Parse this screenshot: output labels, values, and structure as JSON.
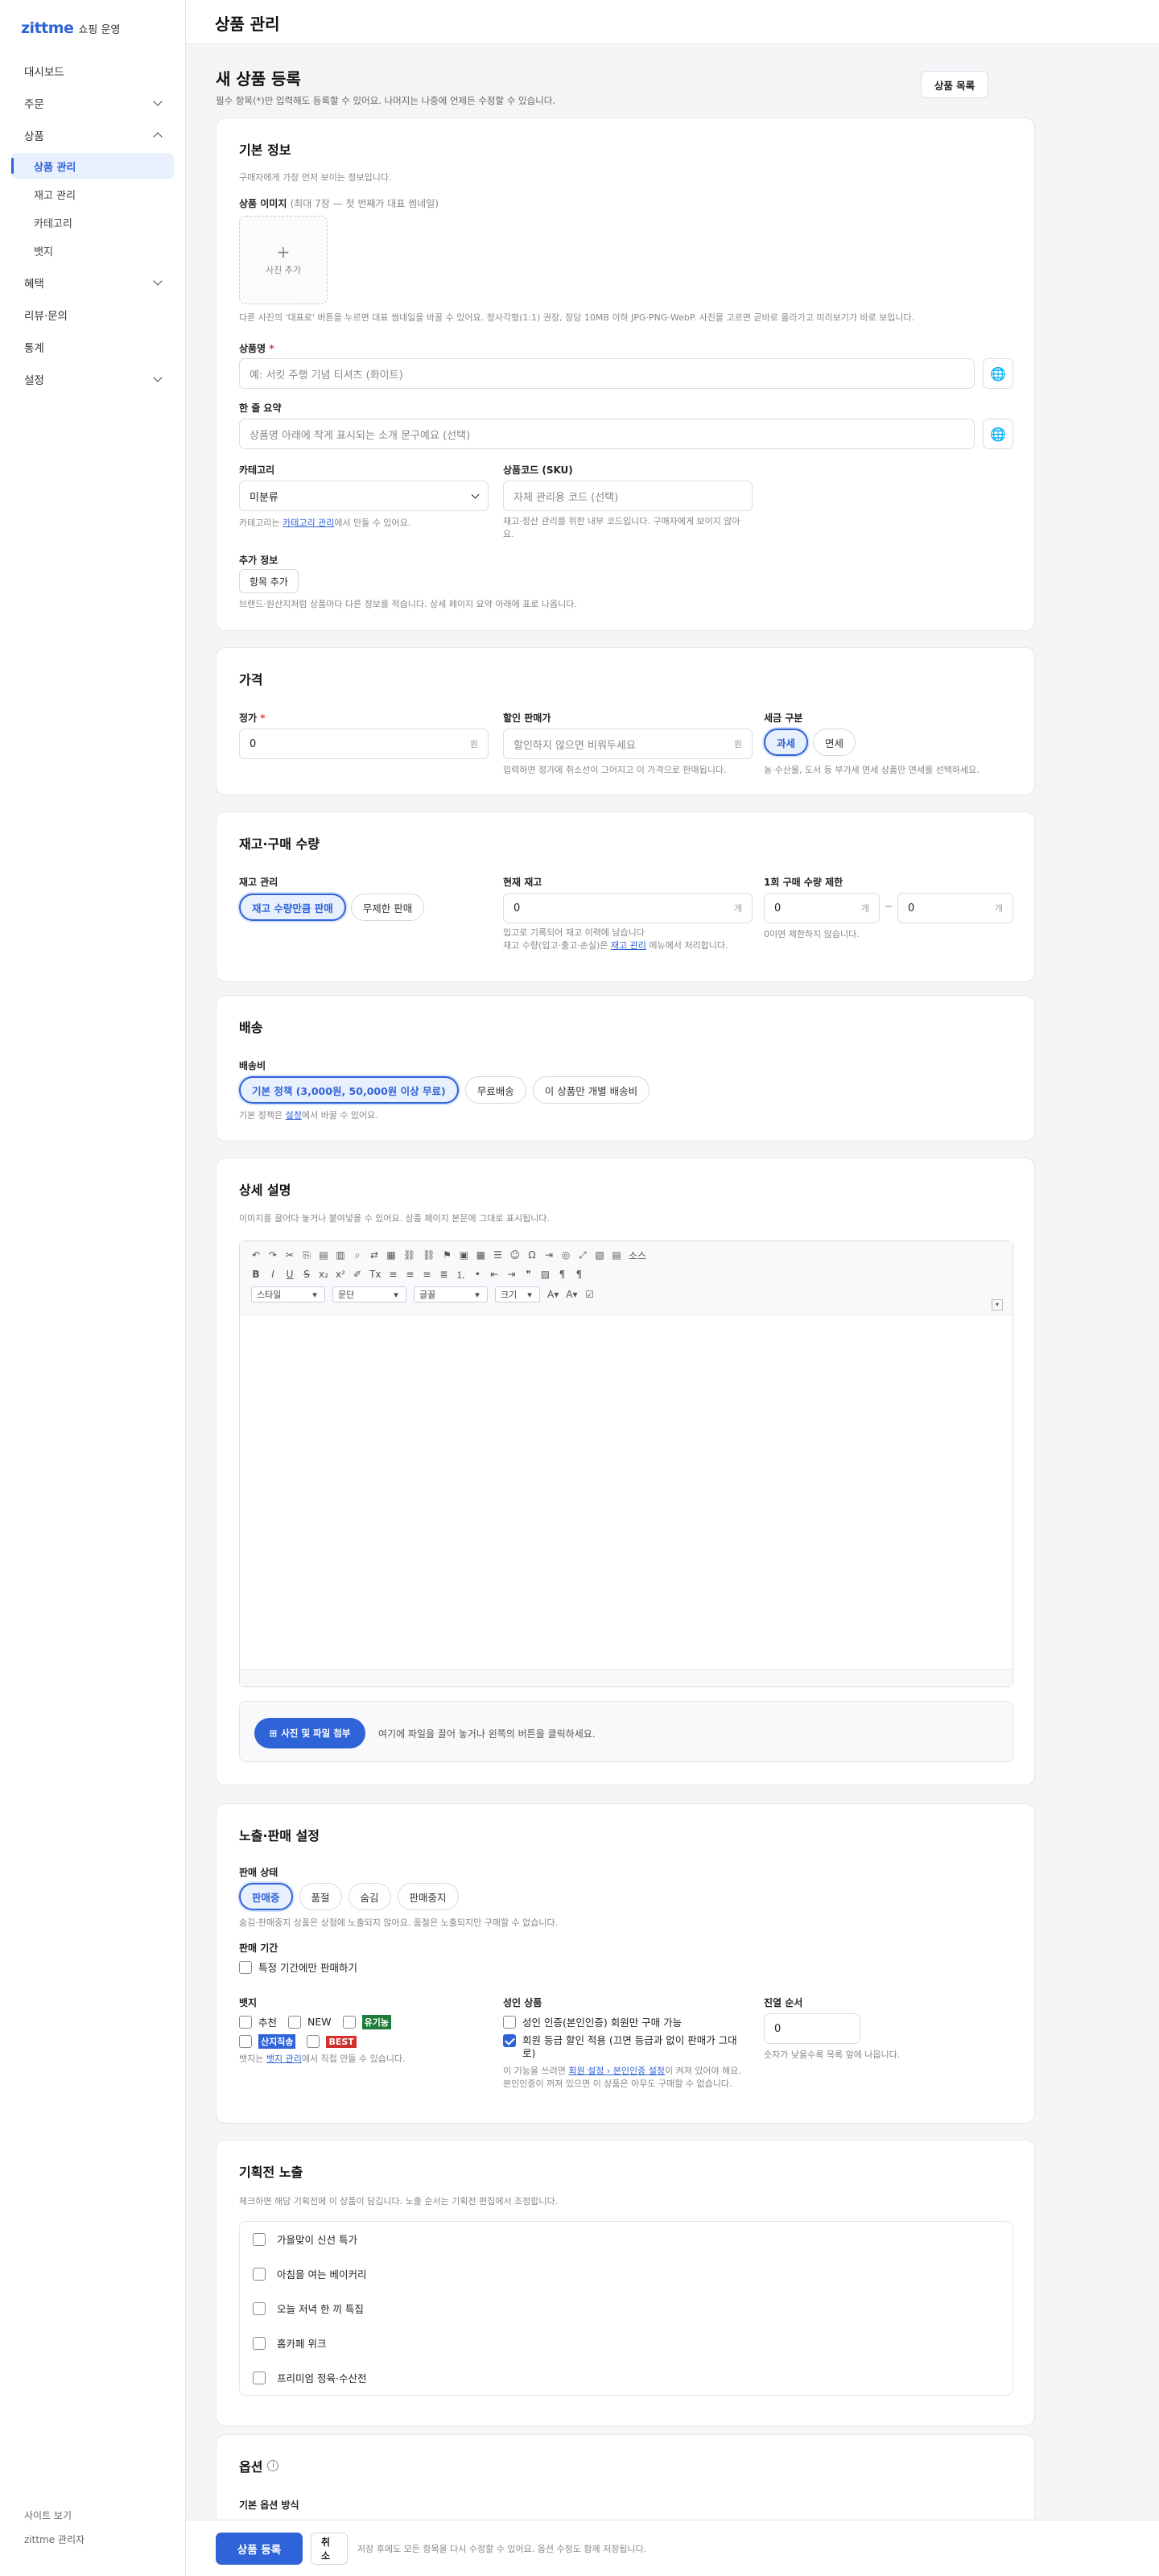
{
  "brand": {
    "logo": "zittme",
    "sub": "쇼핑 운영"
  },
  "nav": {
    "dashboard": "대시보드",
    "orders": "주문",
    "products": "상품",
    "product_manage": "상품 관리",
    "stock_manage": "재고 관리",
    "category": "카테고리",
    "badge": "뱃지",
    "benefits": "혜택",
    "reviews": "리뷰·문의",
    "stats": "통계",
    "settings": "설정"
  },
  "sidebar_bottom": {
    "view_site": "사이트 보기",
    "admin": "zittme 관리자"
  },
  "header": {
    "title": "상품 관리"
  },
  "page": {
    "title": "새 상품 등록",
    "desc": "필수 항목(*)만 입력해도 등록할 수 있어요. 나머지는 나중에 언제든 수정할 수 있습니다.",
    "list_button": "상품 목록"
  },
  "basic": {
    "title": "기본 정보",
    "desc": "구매자에게 가장 먼저 보이는 정보입니다.",
    "image_label": "상품 이미지",
    "image_hint": "(최대 7장 — 첫 번째가 대표 썸네일)",
    "add_photo": "사진 추가",
    "image_help": "다른 사진의 '대표로' 버튼을 누르면 대표 썸네일을 바꿀 수 있어요. 정사각형(1:1) 권장, 장당 10MB 이하 JPG·PNG·WebP. 사진을 고르면 곧바로 올라가고 미리보기가 바로 보입니다.",
    "name_label": "상품명",
    "name_req": "*",
    "name_placeholder": "예: 서킷 주행 기념 티셔츠 (화이트)",
    "summary_label": "한 줄 요약",
    "summary_placeholder": "상품명 아래에 작게 표시되는 소개 문구예요 (선택)",
    "category_label": "카테고리",
    "category_value": "미분류",
    "category_help_pre": "카테고리는 ",
    "category_help_link": "카테고리 관리",
    "category_help_post": "에서 만들 수 있어요.",
    "sku_label": "상품코드 (SKU)",
    "sku_placeholder": "자체 관리용 코드 (선택)",
    "sku_help": "재고·정산 관리를 위한 내부 코드입니다. 구매자에게 보이지 않아요.",
    "extra_label": "추가 정보",
    "extra_button": "항목 추가",
    "extra_help": "브랜드·원산지처럼 상품마다 다른 정보를 적습니다. 상세 페이지 요약 아래에 표로 나옵니다."
  },
  "price": {
    "title": "가격",
    "list_label": "정가",
    "list_req": "*",
    "list_value": "0",
    "unit": "원",
    "sale_label": "할인 판매가",
    "sale_placeholder": "할인하지 않으면 비워두세요",
    "sale_help": "입력하면 정가에 취소선이 그어지고 이 가격으로 판매됩니다.",
    "tax_label": "세금 구분",
    "tax_options": [
      "과세",
      "면세"
    ],
    "tax_help": "농·수산물, 도서 등 부가세 면세 상품만 면세를 선택하세요."
  },
  "stock": {
    "title": "재고·구매 수량",
    "manage_label": "재고 관리",
    "manage_options": [
      "재고 수량만큼 판매",
      "무제한 판매"
    ],
    "current_label": "현재 재고",
    "current_value": "0",
    "unit": "개",
    "current_help1": "입고로 기록되어 재고 이력에 남습니다",
    "current_help2_pre": "재고 수량(입고·출고·손실)은 ",
    "current_help2_link": "재고 관리",
    "current_help2_post": " 메뉴에서 처리합니다.",
    "limit_label": "1회 구매 수량 제한",
    "limit_min": "0",
    "limit_max": "0",
    "limit_sep": "~",
    "limit_help": "0이면 제한하지 않습니다."
  },
  "shipping": {
    "title": "배송",
    "fee_label": "배송비",
    "options": [
      "기본 정책 (3,000원, 50,000원 이상 무료)",
      "무료배송",
      "이 상품만 개별 배송비"
    ],
    "help_pre": "기본 정책은 ",
    "help_link": "설정",
    "help_post": "에서 바꿀 수 있어요."
  },
  "detail": {
    "title": "상세 설명",
    "desc": "이미지를 끌어다 놓거나 붙여넣을 수 있어요. 상품 페이지 본문에 그대로 표시됩니다.",
    "source_label": "소스",
    "style_select": "스타일",
    "para_select": "문단",
    "font_select": "글꼴",
    "size_select": "크기",
    "upload_button": "사진 및 파일 첨부",
    "upload_hint": "여기에 파일을 끌어 놓거나 왼쪽의 버튼을 클릭하세요."
  },
  "display": {
    "title": "노출·판매 설정",
    "status_label": "판매 상태",
    "status_options": [
      "판매중",
      "품절",
      "숨김",
      "판매중지"
    ],
    "status_help": "숨김·판매중지 상품은 상점에 노출되지 않아요. 품절은 노출되지만 구매할 수 없습니다.",
    "period_label": "판매 기간",
    "period_check": "특정 기간에만 판매하기",
    "badge_label": "뱃지",
    "badges": [
      "추천",
      "NEW",
      "유기농",
      "산지직송",
      "BEST"
    ],
    "badge_help_pre": "뱃지는 ",
    "badge_help_link": "뱃지 관리",
    "badge_help_post": "에서 직접 만들 수 있습니다.",
    "adult_label": "성인 상품",
    "adult_check1": "성인 인증(본인인증) 회원만 구매 가능",
    "adult_check2": "회원 등급 할인 적용 (끄면 등급과 없이 판매가 그대로)",
    "adult_help_pre": "이 기능을 쓰려면 ",
    "adult_help_link": "회원 설정 › 본인인증 설정",
    "adult_help_post": "이 켜져 있어야 해요. 본인인증이 꺼져 있으면 이 상품은 아무도 구매할 수 없습니다.",
    "order_label": "진열 순서",
    "order_value": "0",
    "order_help": "숫자가 낮을수록 목록 앞에 나옵니다."
  },
  "special": {
    "title": "기획전 노출",
    "desc": "체크하면 해당 기획전에 이 상품이 담깁니다. 노출 순서는 기획전 편집에서 조정합니다.",
    "items": [
      "가을맞이 신선 특가",
      "아침을 여는 베이커리",
      "오늘 저녁 한 끼 특집",
      "홈카페 위크",
      "프리미엄 정육·수산전"
    ]
  },
  "options": {
    "title": "옵션",
    "basic_label": "기본 옵션 방식"
  },
  "bottom": {
    "submit": "상품 등록",
    "cancel": "취소",
    "help": "저장 후에도 모든 항목을 다시 수정할 수 있어요. 옵션 수정도 함께 저장됩니다."
  },
  "colors": {
    "accent": "#2f63d8",
    "badge_green": "#1e7d3a",
    "badge_blue": "#2f63d8",
    "badge_red": "#d22f2f"
  }
}
